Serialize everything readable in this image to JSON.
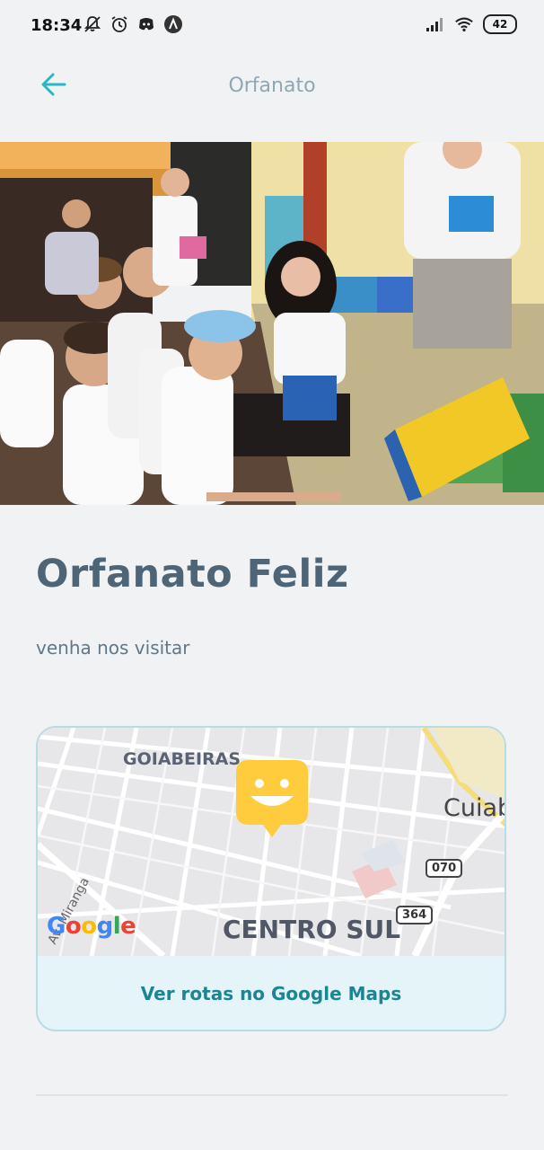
{
  "status_bar": {
    "time": "18:34",
    "battery": "42",
    "icons": [
      "bell-off-icon",
      "alarm-icon",
      "discord-icon",
      "app-a-icon",
      "signal-icon",
      "wifi-icon"
    ]
  },
  "header": {
    "title": "Orfanato",
    "back_icon": "arrow-left-icon"
  },
  "hero": {
    "image": "photo-children-receiving-gifts"
  },
  "main": {
    "title": "Orfanato Feliz",
    "subtitle": "venha nos visitar"
  },
  "map": {
    "labels": {
      "goiabeiras": "GOIABEIRAS",
      "cuiaba": "Cuiab",
      "centro_sul": "CENTRO SUL",
      "avenida": "Av. Miranga",
      "route_070": "070",
      "route_364": "364"
    },
    "google_logo": "Google",
    "marker_icon": "smiley-marker-icon",
    "route_button": "Ver rotas no Google Maps"
  },
  "colors": {
    "accent": "#29b6c9",
    "title": "#4d6577",
    "button_text": "#1c8593",
    "marker": "#ffcc3e"
  }
}
